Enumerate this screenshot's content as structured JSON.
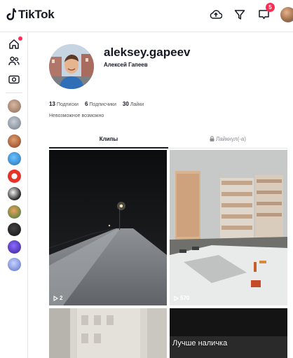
{
  "topbar": {
    "logo_text": "TikTok",
    "icons": [
      "upload-cloud-icon",
      "filter-send-icon",
      "inbox-icon"
    ],
    "notification_count": "5"
  },
  "sidebar": {
    "nav": [
      "home-icon",
      "following-icon",
      "live-icon"
    ],
    "followed_accounts_count": 10
  },
  "profile": {
    "username": "aleksey.gapeev",
    "display_name": "Алексей Гапеев",
    "following_count": "13",
    "following_label": "Подписки",
    "followers_count": "6",
    "followers_label": "Подписчики",
    "likes_count": "30",
    "likes_label": "Лайки",
    "bio": "Невозможное возможно"
  },
  "tabs": {
    "videos": "Клипы",
    "liked": "Лайкнул(-а)"
  },
  "videos": [
    {
      "views": "2",
      "scene": "night-snowy-road"
    },
    {
      "views": "570",
      "scene": "snowy-apartment-blocks"
    },
    {
      "views": "",
      "scene": "pale-building"
    },
    {
      "caption": "Лучше наличка",
      "scene": "dark-frame"
    }
  ],
  "colors": {
    "accent": "#fe2c55",
    "text": "#161823",
    "secondary": "#8a8b91"
  }
}
